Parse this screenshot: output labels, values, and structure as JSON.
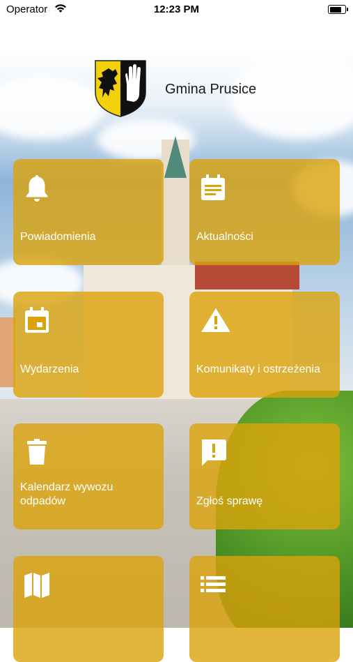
{
  "status_bar": {
    "carrier": "Operator",
    "time": "12:23 PM"
  },
  "header": {
    "title": "Gmina Prusice",
    "crest_icon": "coat-of-arms-icon"
  },
  "accent_color": "#dba30a",
  "tiles": [
    {
      "label": "Powiadomienia",
      "icon": "bell-icon"
    },
    {
      "label": "Aktualności",
      "icon": "news-icon"
    },
    {
      "label": "Wydarzenia",
      "icon": "calendar-icon"
    },
    {
      "label": "Komunikaty i ostrzeżenia",
      "icon": "warning-icon"
    },
    {
      "label": "Kalendarz wywozu odpadów",
      "icon": "trash-icon"
    },
    {
      "label": "Zgłoś sprawę",
      "icon": "report-icon"
    },
    {
      "label": "",
      "icon": "map-icon"
    },
    {
      "label": "",
      "icon": "list-icon"
    }
  ]
}
